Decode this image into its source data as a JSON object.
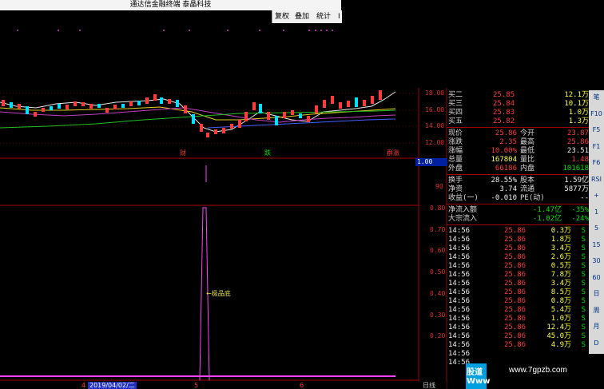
{
  "window": {
    "title": "通达信金融终端 泰晶科技"
  },
  "toolbar": {
    "items": [
      "复权",
      "叠加",
      "统计",
      "I"
    ]
  },
  "price_axis": {
    "ticks": [
      "18.00",
      "16.00",
      "14.00",
      "12.00"
    ]
  },
  "volume_axis": {
    "value_box": "1.00",
    "ticks": [
      "90"
    ]
  },
  "indicator_axis": {
    "ticks": [
      "0.80",
      "0.70",
      "0.60",
      "0.50",
      "0.40",
      "0.30",
      "0.20"
    ]
  },
  "markers": {
    "cai": "财",
    "die": "跌",
    "qun": "群涨"
  },
  "annotation": "←极品底",
  "bottom_bar": {
    "left_num": "4",
    "date": "2019/04/02/二",
    "mid_num": "5",
    "right_num": "6",
    "period": "日线"
  },
  "quote": {
    "asks": [
      {
        "label": "买二",
        "price": "25.85",
        "vol": "12.1万"
      },
      {
        "label": "买三",
        "price": "25.84",
        "vol": "10.1万"
      },
      {
        "label": "买四",
        "price": "25.83",
        "vol": "1.0万"
      },
      {
        "label": "买五",
        "price": "25.82",
        "vol": "1.3万"
      }
    ],
    "stats": [
      {
        "l1": "现价",
        "v1": "25.86",
        "c1": "red",
        "l2": "今开",
        "v2": "23.87",
        "c2": "red"
      },
      {
        "l1": "涨跌",
        "v1": "2.35",
        "c1": "red",
        "l2": "最高",
        "v2": "25.86",
        "c2": "red"
      },
      {
        "l1": "涨幅",
        "v1": "10.00%",
        "c1": "red",
        "l2": "最低",
        "v2": "23.51",
        "c2": "wht"
      },
      {
        "l1": "总量",
        "v1": "167804",
        "c1": "yel",
        "l2": "量比",
        "v2": "1.48",
        "c2": "red"
      },
      {
        "l1": "外盘",
        "v1": "66186",
        "c1": "red",
        "l2": "内盘",
        "v2": "101618",
        "c2": "grn"
      }
    ],
    "stats2": [
      {
        "l1": "换手",
        "v1": "28.55%",
        "l2": "股本",
        "v2": "1.59亿"
      },
      {
        "l1": "净资",
        "v1": "3.74",
        "l2": "流通",
        "v2": "5877万"
      },
      {
        "l1": "收益(一)",
        "v1": "-0.010",
        "l2": "PE(动)",
        "v2": "--"
      }
    ],
    "flows": [
      {
        "label": "净流入额",
        "value": "-1.47亿",
        "pct": "-35%"
      },
      {
        "label": "大宗流入",
        "value": "-1.02亿",
        "pct": "-24%"
      }
    ],
    "ticks": [
      {
        "time": "14:56",
        "price": "25.86",
        "vol": "0.3万",
        "side": "S"
      },
      {
        "time": "14:56",
        "price": "25.86",
        "vol": "1.8万",
        "side": "S"
      },
      {
        "time": "14:56",
        "price": "25.86",
        "vol": "3.4万",
        "side": "S"
      },
      {
        "time": "14:56",
        "price": "25.86",
        "vol": "2.6万",
        "side": "S"
      },
      {
        "time": "14:56",
        "price": "25.86",
        "vol": "0.5万",
        "side": "S"
      },
      {
        "time": "14:56",
        "price": "25.86",
        "vol": "7.8万",
        "side": "S"
      },
      {
        "time": "14:56",
        "price": "25.86",
        "vol": "3.4万",
        "side": "S"
      },
      {
        "time": "14:56",
        "price": "25.86",
        "vol": "8.5万",
        "side": "S"
      },
      {
        "time": "14:56",
        "price": "25.86",
        "vol": "0.8万",
        "side": "S"
      },
      {
        "time": "14:56",
        "price": "25.86",
        "vol": "5.4万",
        "side": "S"
      },
      {
        "time": "14:56",
        "price": "25.86",
        "vol": "1.0万",
        "side": "S"
      },
      {
        "time": "14:56",
        "price": "25.86",
        "vol": "12.4万",
        "side": "S"
      },
      {
        "time": "14:56",
        "price": "25.86",
        "vol": "45.0万",
        "side": "S"
      },
      {
        "time": "14:56",
        "price": "25.86",
        "vol": "4.9万",
        "side": "S"
      },
      {
        "time": "14:56",
        "price": "",
        "vol": "",
        "side": ""
      },
      {
        "time": "14:56",
        "price": "",
        "vol": "",
        "side": ""
      }
    ]
  },
  "sidebar": {
    "items": [
      "笔",
      "F10",
      "F5",
      "F1",
      "F6",
      "RSI",
      "+",
      "1",
      "5",
      "15",
      "30",
      "60",
      "日",
      "周",
      "月",
      "D"
    ]
  },
  "watermark": {
    "logo": "股道Www",
    "url": "www.7gpzb.com"
  },
  "colors": {
    "up": "#ff3b3b",
    "down": "#00e0ff",
    "indicator": "#ff40ff",
    "axis": "#a00000"
  }
}
